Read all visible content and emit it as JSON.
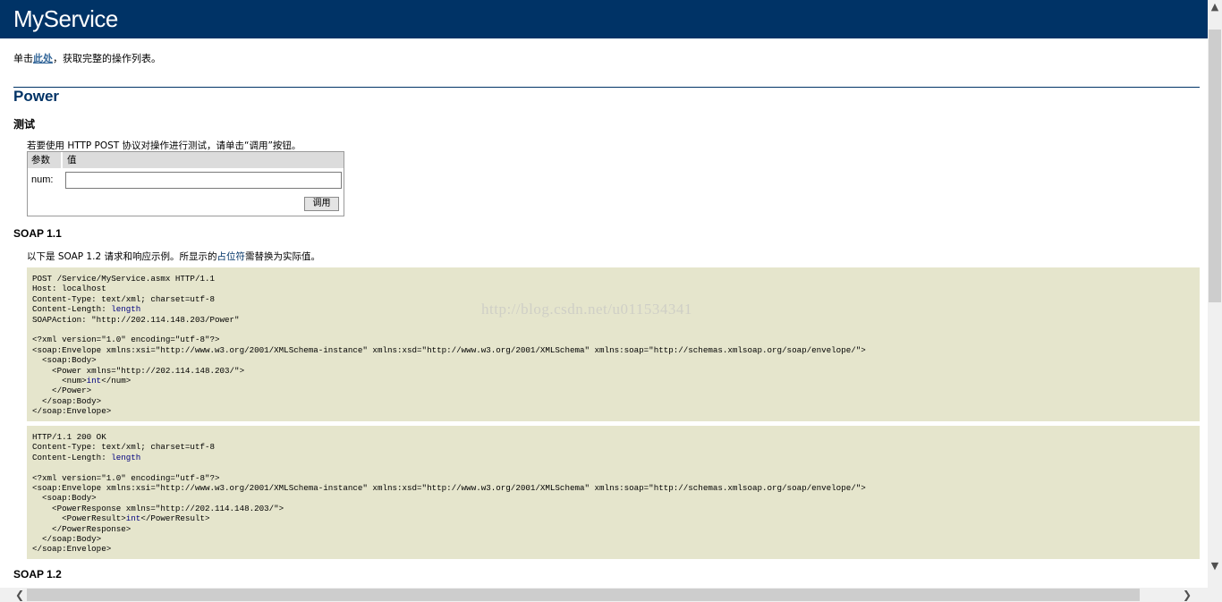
{
  "header": {
    "title": "MyService"
  },
  "intro": {
    "prefix": "单击",
    "link": "此处",
    "suffix": "，获取完整的操作列表。"
  },
  "operation": {
    "name": "Power",
    "test": {
      "heading": "测试",
      "description": "若要使用 HTTP POST 协议对操作进行测试，请单击“调用”按钮。",
      "columns": [
        "参数",
        "值"
      ],
      "param_label": "num:",
      "param_value": "",
      "invoke_label": "调用"
    },
    "soap11": {
      "heading": "SOAP 1.1",
      "desc_prefix": "以下是 SOAP 1.2 请求和响应示例。所显示的",
      "desc_highlight": "占位符",
      "desc_suffix": "需替换为实际值。",
      "request": {
        "l1": "POST /Service/MyService.asmx HTTP/1.1",
        "l2": "Host: localhost",
        "l3": "Content-Type: text/xml; charset=utf-8",
        "l4_prefix": "Content-Length: ",
        "l4_value": "length",
        "l5": "SOAPAction: \"http://202.114.148.203/Power\"",
        "l7": "<?xml version=\"1.0\" encoding=\"utf-8\"?>",
        "l8": "<soap:Envelope xmlns:xsi=\"http://www.w3.org/2001/XMLSchema-instance\" xmlns:xsd=\"http://www.w3.org/2001/XMLSchema\" xmlns:soap=\"http://schemas.xmlsoap.org/soap/envelope/\">",
        "l9": "  <soap:Body>",
        "l10": "    <Power xmlns=\"http://202.114.148.203/\">",
        "l11_open": "      <num>",
        "l11_value": "int",
        "l11_close": "</num>",
        "l12": "    </Power>",
        "l13": "  </soap:Body>",
        "l14": "</soap:Envelope>"
      },
      "response": {
        "l1": "HTTP/1.1 200 OK",
        "l2": "Content-Type: text/xml; charset=utf-8",
        "l3_prefix": "Content-Length: ",
        "l3_value": "length",
        "l5": "<?xml version=\"1.0\" encoding=\"utf-8\"?>",
        "l6": "<soap:Envelope xmlns:xsi=\"http://www.w3.org/2001/XMLSchema-instance\" xmlns:xsd=\"http://www.w3.org/2001/XMLSchema\" xmlns:soap=\"http://schemas.xmlsoap.org/soap/envelope/\">",
        "l7": "  <soap:Body>",
        "l8": "    <PowerResponse xmlns=\"http://202.114.148.203/\">",
        "l9_open": "      <PowerResult>",
        "l9_value": "int",
        "l9_close": "</PowerResult>",
        "l10": "    </PowerResponse>",
        "l11": "  </soap:Body>",
        "l12": "</soap:Envelope>"
      }
    },
    "soap12": {
      "heading": "SOAP 1.2"
    }
  },
  "watermark": "http://blog.csdn.net/u011534341",
  "scrollbars": {
    "up_icon": "▲",
    "down_icon": "▼",
    "left_icon": "❮",
    "right_icon": "❯"
  }
}
